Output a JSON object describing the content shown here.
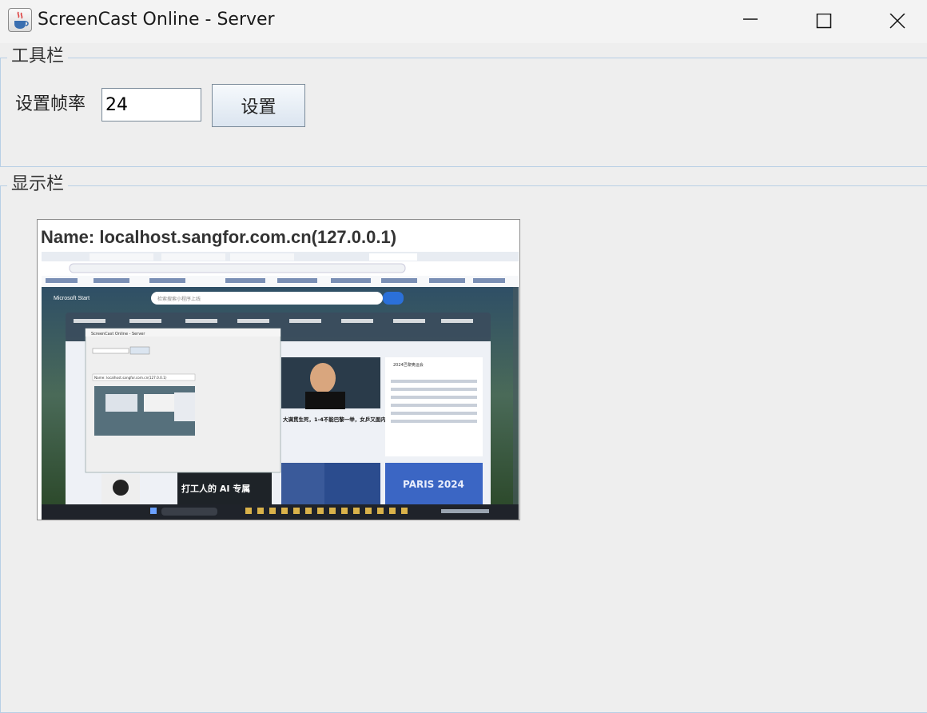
{
  "window": {
    "title": "ScreenCast Online - Server",
    "icon": "java-cup-icon",
    "controls": [
      "minimize-icon",
      "maximize-icon",
      "close-icon"
    ]
  },
  "toolbar_panel": {
    "title": "工具栏",
    "frame_rate_label": "设置帧率",
    "frame_rate_value": "24",
    "set_button_label": "设置"
  },
  "display_panel": {
    "title": "显示栏",
    "client_name": "Name: localhost.sangfor.com.cn(127.0.0.1)",
    "snapshot": {
      "search_placeholder": "检索搜索小程序上线",
      "card_headline": "大满贯生死，1-4不能巴黎一举，女乒又面内忧？",
      "medal_widget_title": "2024巴黎奥运会",
      "banner_text": "打工人的 AI 专属",
      "paris_text": "PARIS 2024"
    }
  },
  "colors": {
    "panel_border": "#b8cfe5",
    "background": "#eeeeee",
    "button_gradient_top": "#f6f9fc",
    "button_gradient_bottom": "#dbe5f0"
  }
}
